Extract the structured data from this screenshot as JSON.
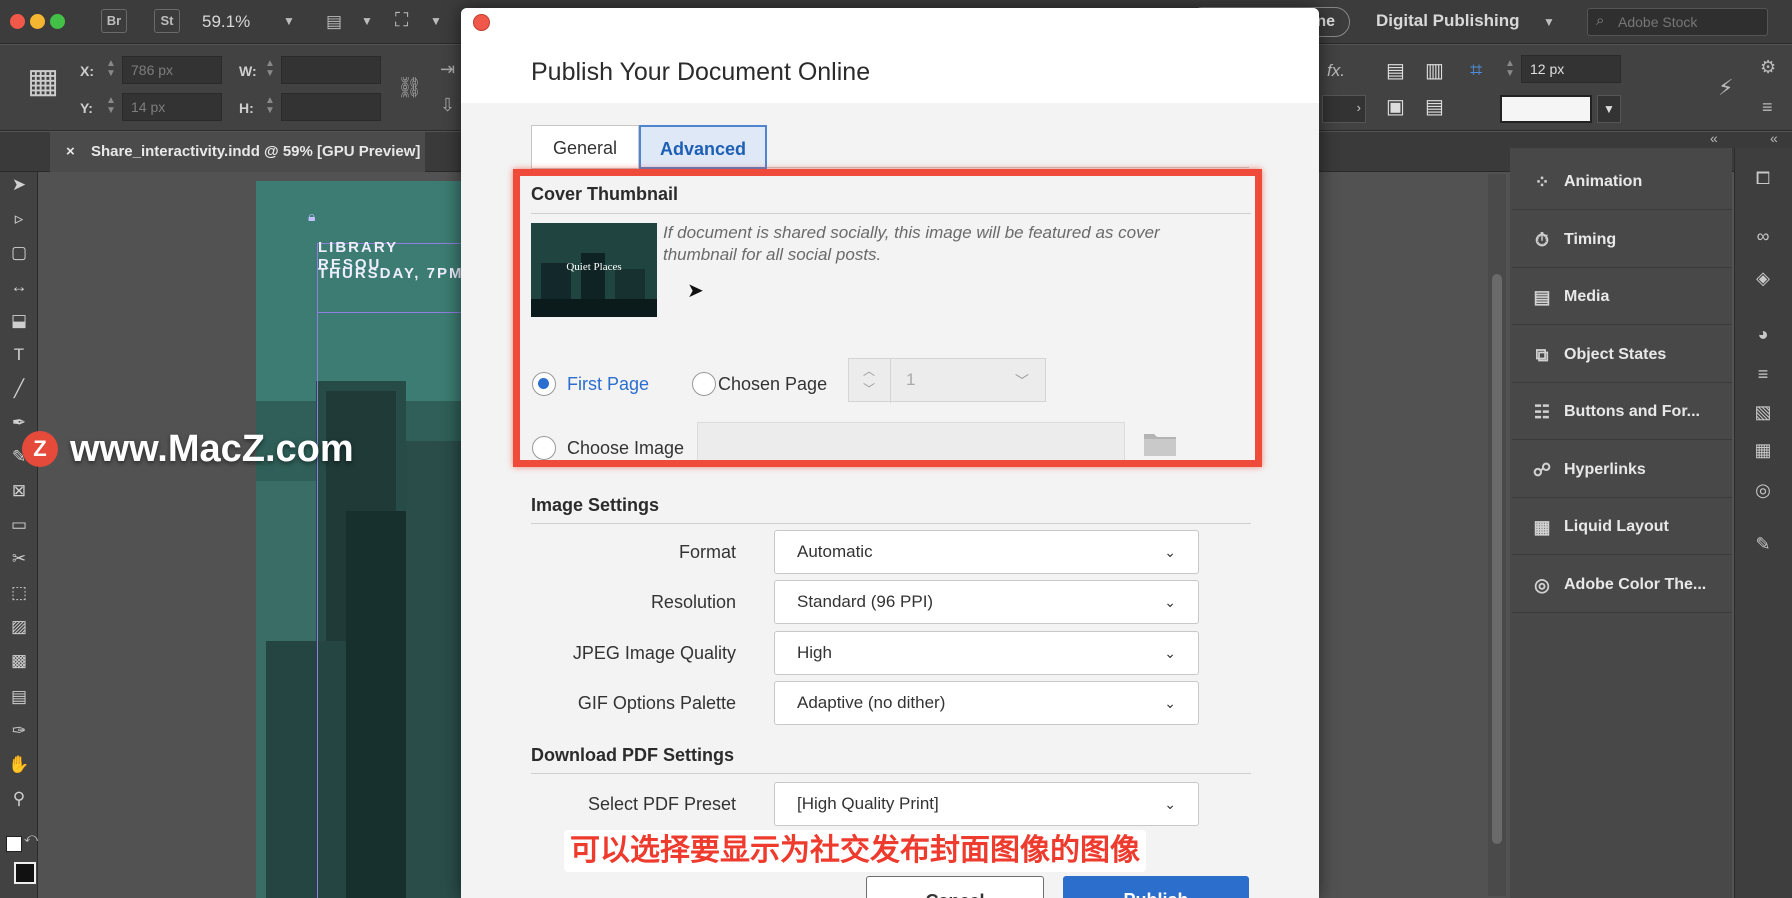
{
  "appbar": {
    "br": "Br",
    "st": "St",
    "zoom": "59.1%",
    "workspace_partial": "ne",
    "workspace": "Digital Publishing",
    "search_placeholder": "Adobe Stock"
  },
  "control": {
    "x_label": "X:",
    "x_value": "786 px",
    "y_label": "Y:",
    "y_value": "14 px",
    "w_label": "W:",
    "h_label": "H:",
    "fx": "fx.",
    "stroke_value": "12 px"
  },
  "doc_tab": {
    "close": "×",
    "title": "Share_interactivity.indd @ 59% [GPU Preview]"
  },
  "page": {
    "line1": "LIBRARY RESOU",
    "line2": "THURSDAY, 7PM"
  },
  "panels": [
    {
      "icon": "animation-icon",
      "label": "Animation"
    },
    {
      "icon": "timing-icon",
      "label": "Timing"
    },
    {
      "icon": "media-icon",
      "label": "Media"
    },
    {
      "icon": "object-states-icon",
      "label": "Object States"
    },
    {
      "icon": "buttons-forms-icon",
      "label": "Buttons and For..."
    },
    {
      "icon": "hyperlinks-icon",
      "label": "Hyperlinks"
    },
    {
      "icon": "liquid-layout-icon",
      "label": "Liquid Layout"
    },
    {
      "icon": "adobe-color-icon",
      "label": "Adobe Color The..."
    }
  ],
  "dialog": {
    "title": "Publish Your Document Online",
    "tabs": {
      "general": "General",
      "advanced": "Advanced"
    },
    "cover": {
      "heading": "Cover Thumbnail",
      "thumb_text": "Quiet Places",
      "description": "If document is shared socially, this image will be featured as cover thumbnail for all social posts.",
      "first_page": "First Page",
      "chosen_page": "Chosen Page",
      "page_number": "1",
      "choose_image": "Choose Image",
      "selected": "First Page"
    },
    "image_settings": {
      "heading": "Image Settings",
      "rows": [
        {
          "label": "Format",
          "value": "Automatic"
        },
        {
          "label": "Resolution",
          "value": "Standard (96 PPI)"
        },
        {
          "label": "JPEG Image Quality",
          "value": "High"
        },
        {
          "label": "GIF Options Palette",
          "value": "Adaptive (no dither)"
        }
      ]
    },
    "pdf": {
      "heading": "Download PDF Settings",
      "label": "Select PDF Preset",
      "value": "[High Quality Print]"
    },
    "buttons": {
      "cancel": "Cancel",
      "publish": "Publish"
    }
  },
  "watermark": {
    "logo": "Z",
    "text": "www.MacZ.com"
  },
  "subtitle": "可以选择要显示为社交发布封面图像的图像"
}
